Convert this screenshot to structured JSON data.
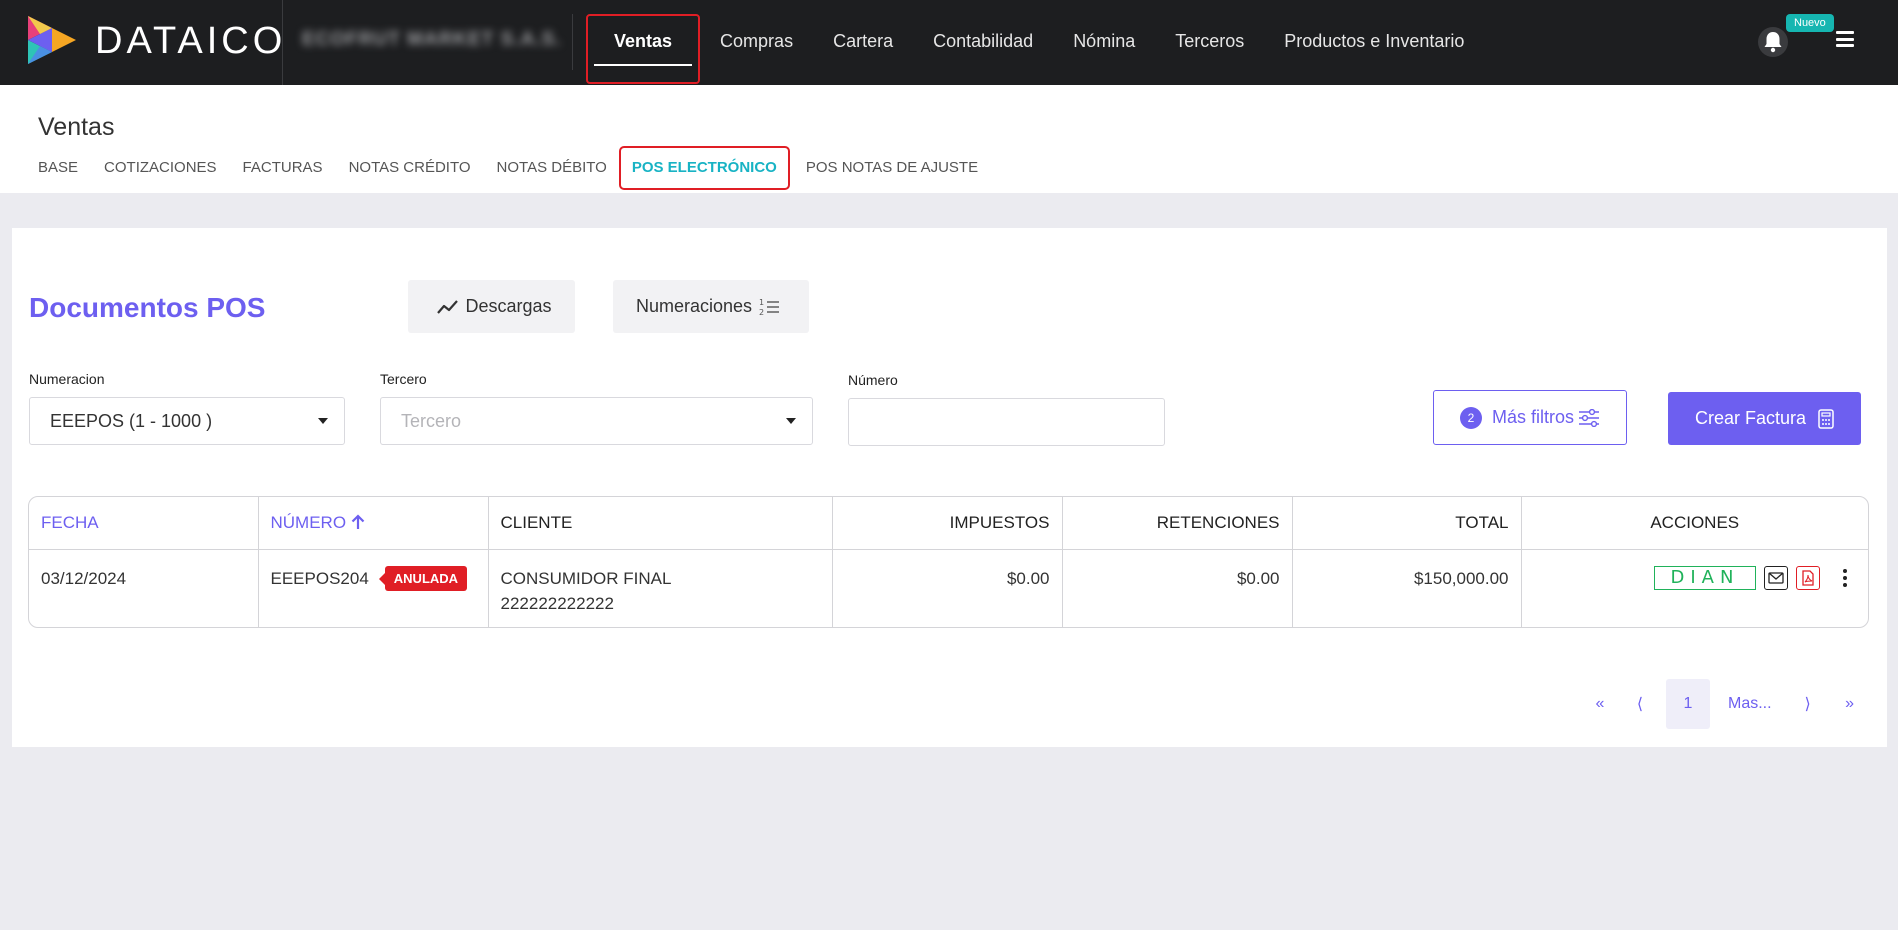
{
  "app": {
    "brand": "DATAICO",
    "company": "ECOFRUT MARKET S.A.S."
  },
  "main_nav": [
    {
      "label": "Ventas",
      "active": true
    },
    {
      "label": "Compras"
    },
    {
      "label": "Cartera"
    },
    {
      "label": "Contabilidad"
    },
    {
      "label": "Nómina"
    },
    {
      "label": "Terceros"
    },
    {
      "label": "Productos e Inventario"
    }
  ],
  "header_right": {
    "badge": "Nuevo",
    "icons": [
      "bell-icon",
      "hamburger-menu-icon"
    ]
  },
  "page": {
    "title": "Ventas"
  },
  "sub_tabs": [
    {
      "label": "BASE"
    },
    {
      "label": "COTIZACIONES"
    },
    {
      "label": "FACTURAS"
    },
    {
      "label": "NOTAS CRÉDITO"
    },
    {
      "label": "NOTAS DÉBITO"
    },
    {
      "label": "POS ELECTRÓNICO",
      "active": true
    },
    {
      "label": "POS NOTAS DE AJUSTE"
    }
  ],
  "card": {
    "title": "Documentos POS",
    "downloads_label": "Descargas",
    "numerations_label": "Numeraciones",
    "filters": {
      "numeracion_label": "Numeracion",
      "numeracion_value": "EEEPOS (1 - 1000 )",
      "tercero_label": "Tercero",
      "tercero_placeholder": "Tercero",
      "numero_label": "Número",
      "numero_value": ""
    },
    "more_filters": {
      "count": "2",
      "label": "Más filtros"
    },
    "create_label": "Crear Factura"
  },
  "table": {
    "columns": [
      "FECHA",
      "NÚMERO",
      "CLIENTE",
      "IMPUESTOS",
      "RETENCIONES",
      "TOTAL",
      "ACCIONES"
    ],
    "rows": [
      {
        "fecha": "03/12/2024",
        "numero": "EEEPOS204",
        "status": "ANULADA",
        "cliente_nombre": "CONSUMIDOR FINAL",
        "cliente_id": "222222222222",
        "impuestos": "$0.00",
        "retenciones": "$0.00",
        "total": "$150,000.00",
        "dian_label": "DIAN"
      }
    ]
  },
  "pagination": {
    "first": "«",
    "prev": "⟨",
    "current": "1",
    "more": "Mas...",
    "next": "⟩",
    "last": "»"
  },
  "colors": {
    "accent": "#6d5ff0",
    "teal": "#18b3c4",
    "highlight": "#e01e25",
    "dian_green": "#20b25a",
    "topbar": "#1d1e20"
  }
}
